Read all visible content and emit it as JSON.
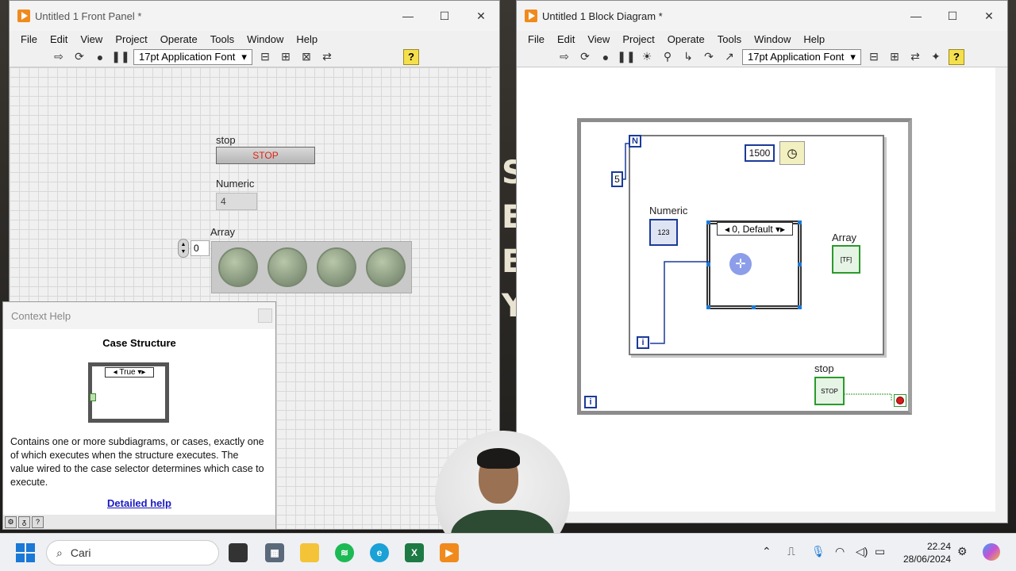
{
  "front_panel": {
    "title": "Untitled 1 Front Panel *",
    "menu": [
      "File",
      "Edit",
      "View",
      "Project",
      "Operate",
      "Tools",
      "Window",
      "Help"
    ],
    "font": "17pt Application Font",
    "stop_label": "stop",
    "stop_button_text": "STOP",
    "numeric_label": "Numeric",
    "numeric_value": "4",
    "array_label": "Array",
    "array_index": "0",
    "leds": [
      false,
      false,
      false,
      false
    ]
  },
  "context_help": {
    "title": "Context Help",
    "heading": "Case Structure",
    "selector_text": "True",
    "description": "Contains one or more subdiagrams, or cases, exactly one of which executes when the structure executes. The value wired to the case selector determines which case to execute.",
    "link": "Detailed help"
  },
  "block_diagram": {
    "title": "Untitled 1 Block Diagram *",
    "menu": [
      "File",
      "Edit",
      "View",
      "Project",
      "Operate",
      "Tools",
      "Window",
      "Help"
    ],
    "font": "17pt Application Font",
    "count_terminal": "N",
    "count_constant": "5",
    "iteration_terminal": "i",
    "wait_constant": "1500",
    "numeric_label": "Numeric",
    "numeric_term": "123",
    "case_selector": "0, Default",
    "array_label": "Array",
    "stop_label": "stop",
    "stop_term": "STOP"
  },
  "taskbar": {
    "search_placeholder": "Cari",
    "time": "22.24",
    "date": "28/06/2024"
  },
  "colors": {
    "labview_blue": "#1b3a9a",
    "bool_green": "#2b9a2b",
    "accent_orange": "#f08a1c"
  }
}
